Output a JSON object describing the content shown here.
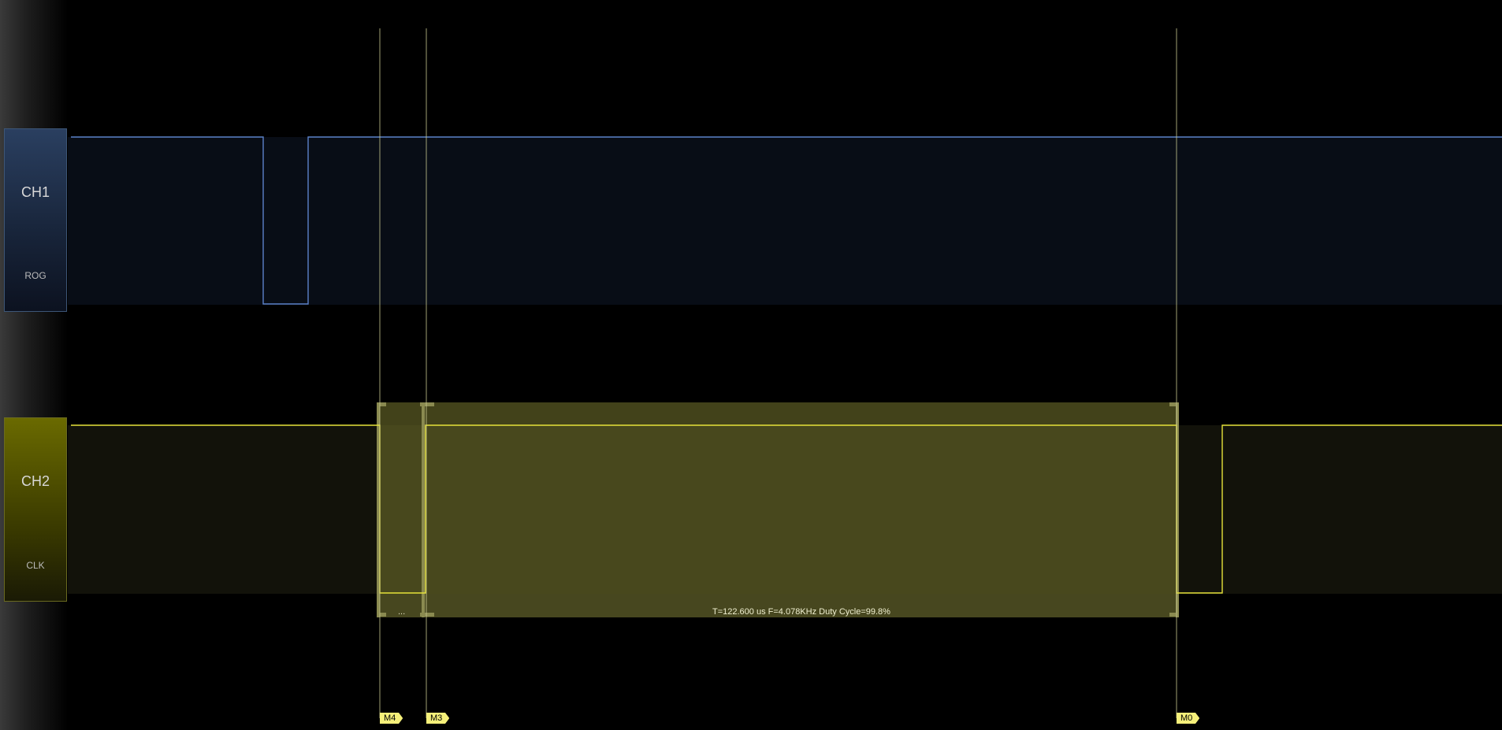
{
  "channels": [
    {
      "id": "ch1",
      "name": "CH1",
      "alias": "ROG",
      "color": "#5b82c9"
    },
    {
      "id": "ch2",
      "name": "CH2",
      "alias": "CLK",
      "color": "#e6e23a"
    }
  ],
  "measurement": {
    "text": "T=122.600 us   F=4.078KHz   Duty Cycle=99.8%",
    "overflow_text": "..."
  },
  "markers": [
    {
      "id": "m4",
      "label": "M4"
    },
    {
      "id": "m3",
      "label": "M3"
    },
    {
      "id": "m0",
      "label": "M0"
    }
  ],
  "colors": {
    "background": "#000000",
    "ch1_trace": "#5b82c9",
    "ch2_trace": "#e6e23a",
    "measure_region": "#6a6a2a",
    "marker_tag": "#f5f07a"
  }
}
